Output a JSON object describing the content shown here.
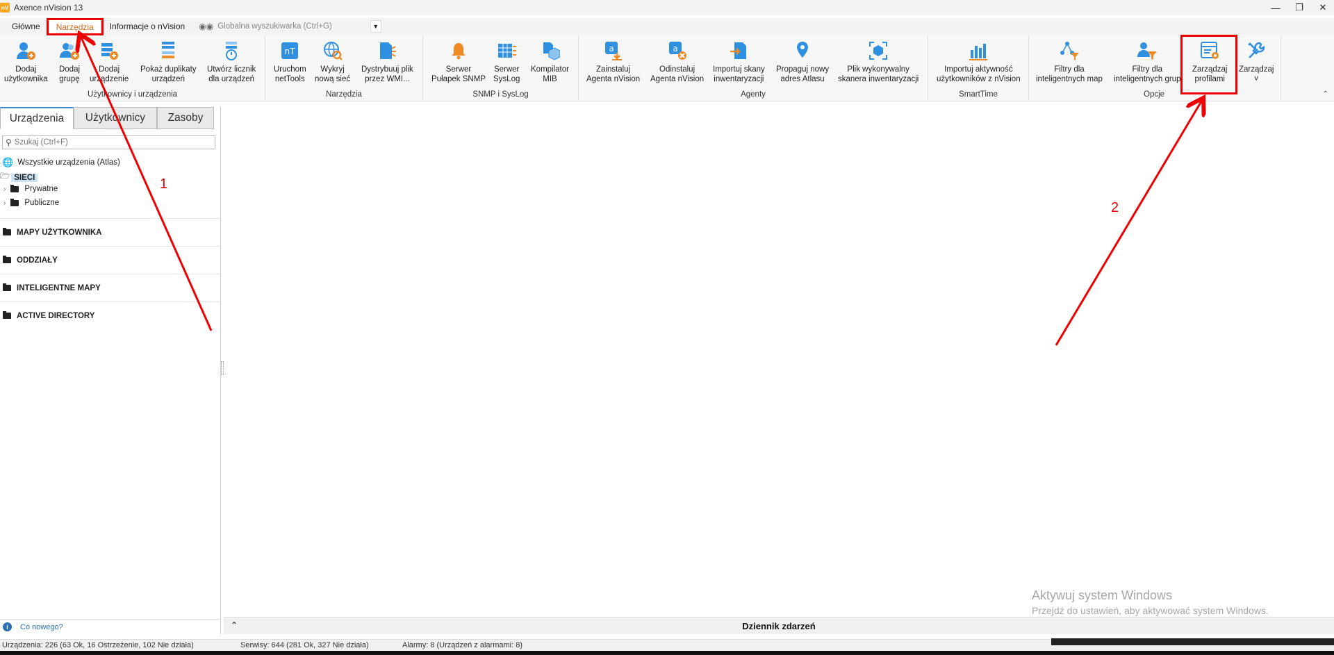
{
  "window": {
    "title": "Axence nVision 13",
    "logo_text": "nV"
  },
  "menu": {
    "tabs": [
      "Główne",
      "Narzędzia",
      "Informacje o nVision"
    ],
    "active_tab": "Narzędzia",
    "global_search": "Globalna wyszukiwarka (Ctrl+G)"
  },
  "ribbon": {
    "groups": [
      {
        "label": "Użytkownicy i urządzenia",
        "buttons": [
          {
            "line1": "Dodaj",
            "line2": "użytkownika",
            "icon": "add-user-icon"
          },
          {
            "line1": "Dodaj",
            "line2": "grupę",
            "icon": "add-group-icon"
          },
          {
            "line1": "Dodaj",
            "line2": "urządzenie",
            "icon": "add-device-icon"
          },
          {
            "line1": "Pokaż duplikaty",
            "line2": "urządzeń",
            "icon": "duplicates-icon"
          },
          {
            "line1": "Utwórz licznik",
            "line2": "dla urządzeń",
            "icon": "counter-icon"
          }
        ]
      },
      {
        "label": "Narzędzia",
        "buttons": [
          {
            "line1": "Uruchom",
            "line2": "netTools",
            "icon": "nettools-icon"
          },
          {
            "line1": "Wykryj",
            "line2": "nową sieć",
            "icon": "discover-network-icon"
          },
          {
            "line1": "Dystrybuuj plik",
            "line2": "przez WMI...",
            "icon": "distribute-file-icon"
          }
        ]
      },
      {
        "label": "SNMP i SysLog",
        "buttons": [
          {
            "line1": "Serwer",
            "line2": "Pułapek SNMP",
            "icon": "snmp-bell-icon"
          },
          {
            "line1": "Serwer",
            "line2": "SysLog",
            "icon": "syslog-icon"
          },
          {
            "line1": "Kompilator",
            "line2": "MIB",
            "icon": "mib-compiler-icon"
          }
        ]
      },
      {
        "label": "Agenty",
        "buttons": [
          {
            "line1": "Zainstaluj",
            "line2": "Agenta nVision",
            "icon": "install-agent-icon"
          },
          {
            "line1": "Odinstaluj",
            "line2": "Agenta nVision",
            "icon": "uninstall-agent-icon"
          },
          {
            "line1": "Importuj skany",
            "line2": "inwentaryzacji",
            "icon": "import-scans-icon"
          },
          {
            "line1": "Propaguj nowy",
            "line2": "adres Atlasu",
            "icon": "propagate-atlas-icon"
          },
          {
            "line1": "Plik wykonywalny",
            "line2": "skanera inwentaryzacji",
            "icon": "scanner-executable-icon"
          }
        ]
      },
      {
        "label": "SmartTime",
        "buttons": [
          {
            "line1": "Importuj aktywność",
            "line2": "użytkowników z nVision",
            "icon": "import-activity-icon"
          }
        ]
      },
      {
        "label": "Opcje",
        "buttons": [
          {
            "line1": "Filtry dla",
            "line2": "inteligentnych map",
            "icon": "map-filter-icon"
          },
          {
            "line1": "Filtry dla",
            "line2": "inteligentnych grup",
            "icon": "group-filter-icon"
          },
          {
            "line1": "Zarządzaj",
            "line2": "profilami",
            "icon": "manage-profiles-icon"
          },
          {
            "line1": "Zarządzaj",
            "line2": "˅",
            "icon": "manage-tools-icon"
          }
        ]
      }
    ]
  },
  "left_panel": {
    "tabs": [
      "Urządzenia",
      "Użytkownicy",
      "Zasoby"
    ],
    "active_tab": "Urządzenia",
    "search_placeholder": "Szukaj (Ctrl+F)",
    "tree": {
      "all_devices": "Wszystkie urządzenia (Atlas)",
      "networks": "SIECI",
      "children": [
        "Prywatne",
        "Publiczne"
      ]
    },
    "sections": [
      "MAPY UŻYTKOWNIKA",
      "ODDZIAŁY",
      "INTELIGENTNE MAPY",
      "ACTIVE DIRECTORY"
    ],
    "whats_new": "Co nowego?"
  },
  "event_log": {
    "title": "Dziennik zdarzeń",
    "toggle": "⌃"
  },
  "watermark": {
    "line1": "Aktywuj system Windows",
    "line2": "Przejdź do ustawień, aby aktywować system Windows."
  },
  "status_bar": {
    "devices": "Urządzenia: 226 (63 Ok, 16 Ostrzeżenie, 102 Nie działa)",
    "services": "Serwisy: 644 (281 Ok, 327 Nie działa)",
    "alarms": "Alarmy: 8 (Urządzeń z alarmami: 8)"
  },
  "annotations": {
    "label_1": "1",
    "label_2": "2",
    "color": "#e00000"
  },
  "colors": {
    "accent": "#3a8fd6",
    "active_tab_text": "#d56b1b",
    "icon_blue": "#2f8fe0",
    "icon_orange": "#f08a24"
  }
}
